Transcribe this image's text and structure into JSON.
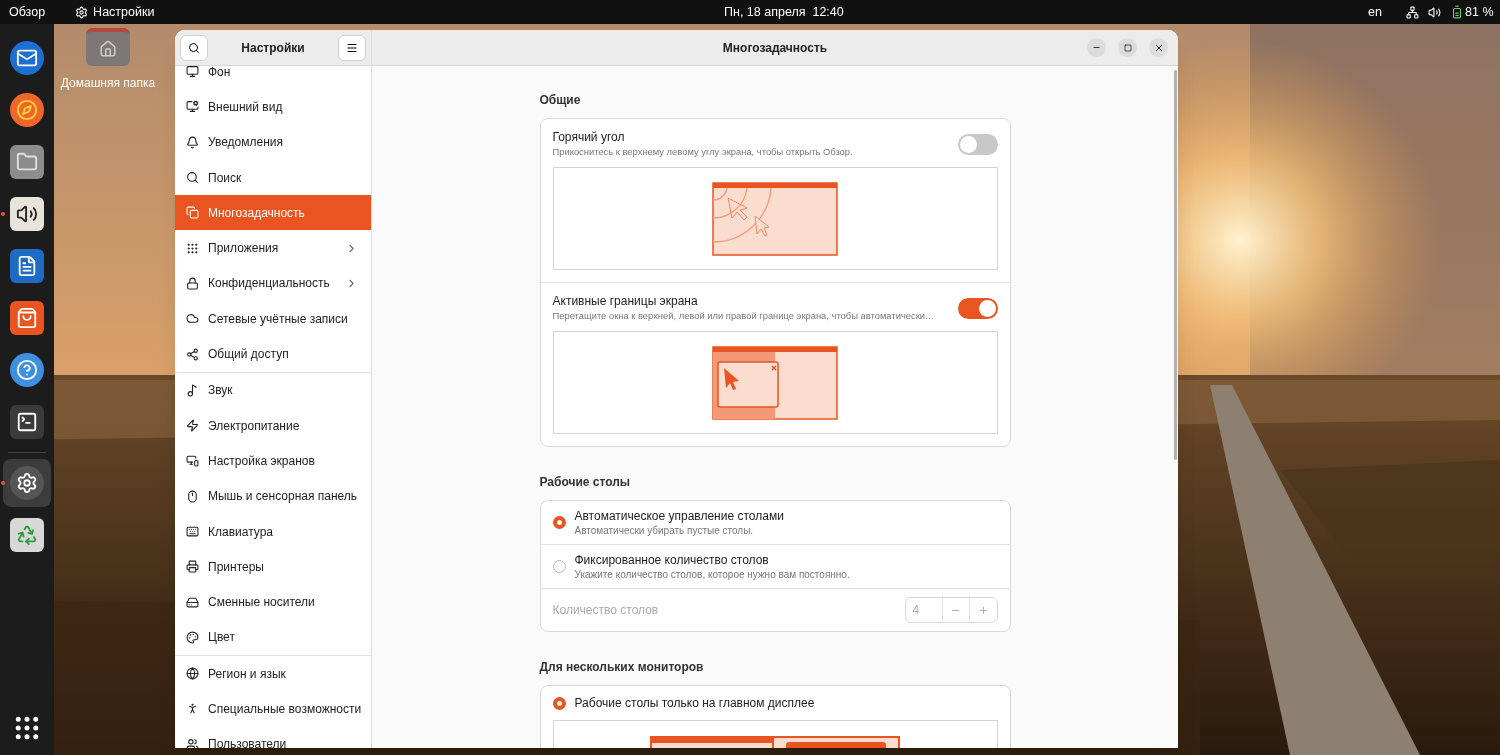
{
  "top_bar": {
    "activities": "Обзор",
    "app_name": "Настройки",
    "clock": "Пн, 18 апреля  12:40",
    "language": "en",
    "battery": "81 %"
  },
  "dock": {
    "items": [
      {
        "running": false,
        "selected": false
      },
      {
        "running": false,
        "selected": false
      },
      {
        "running": false,
        "selected": false
      },
      {
        "running": true,
        "selected": false
      },
      {
        "running": false,
        "selected": false
      },
      {
        "running": false,
        "selected": false
      },
      {
        "running": false,
        "selected": false
      },
      {
        "running": false,
        "selected": false
      },
      {
        "running": true,
        "selected": true
      },
      {
        "running": false,
        "selected": false
      }
    ]
  },
  "desktop": {
    "icons": [
      {
        "label": "Домашняя папка"
      }
    ]
  },
  "window": {
    "sidebar": {
      "title": "Настройки",
      "groups": [
        [
          {
            "label": "Фон",
            "selected": false,
            "expandable": false
          },
          {
            "label": "Внешний вид",
            "selected": false,
            "expandable": false
          },
          {
            "label": "Уведомления",
            "selected": false,
            "expandable": false
          },
          {
            "label": "Поиск",
            "selected": false,
            "expandable": false
          },
          {
            "label": "Многозадачность",
            "selected": true,
            "expandable": false
          },
          {
            "label": "Приложения",
            "selected": false,
            "expandable": true
          },
          {
            "label": "Конфиденциальность",
            "selected": false,
            "expandable": true
          },
          {
            "label": "Сетевые учётные записи",
            "selected": false,
            "expandable": false
          },
          {
            "label": "Общий доступ",
            "selected": false,
            "expandable": false
          }
        ],
        [
          {
            "label": "Звук",
            "selected": false,
            "expandable": false
          },
          {
            "label": "Электропитание",
            "selected": false,
            "expandable": false
          },
          {
            "label": "Настройка экранов",
            "selected": false,
            "expandable": false
          },
          {
            "label": "Мышь и сенсорная панель",
            "selected": false,
            "expandable": false
          },
          {
            "label": "Клавиатура",
            "selected": false,
            "expandable": false
          },
          {
            "label": "Принтеры",
            "selected": false,
            "expandable": false
          },
          {
            "label": "Сменные носители",
            "selected": false,
            "expandable": false
          },
          {
            "label": "Цвет",
            "selected": false,
            "expandable": false
          }
        ],
        [
          {
            "label": "Регион и язык",
            "selected": false,
            "expandable": false
          },
          {
            "label": "Специальные возможности",
            "selected": false,
            "expandable": false
          },
          {
            "label": "Пользователи",
            "selected": false,
            "expandable": false
          }
        ]
      ]
    },
    "title": "Многозадачность",
    "sections": [
      {
        "heading": "Общие",
        "rows": [
          {
            "kind": "toggle",
            "title": "Горячий угол",
            "subtitle": "Прикоснитесь к верхнему левому углу экрана, чтобы открыть Обзор.",
            "on": false
          },
          {
            "kind": "toggle",
            "title": "Активные границы экрана",
            "subtitle": "Перетащите окна к верхней, левой или правой границе экрана, чтобы автоматически…",
            "on": true
          }
        ]
      },
      {
        "heading": "Рабочие столы",
        "rows": [
          {
            "kind": "radio",
            "title": "Автоматическое управление столами",
            "subtitle": "Автоматически убирать пустые столы.",
            "selected": true
          },
          {
            "kind": "radio",
            "title": "Фиксированное количество столов",
            "subtitle": "Укажите количество столов, которое нужно вам постоянно.",
            "selected": false
          },
          {
            "kind": "spin",
            "label": "Количество столов",
            "value": "4",
            "disabled": true
          }
        ]
      },
      {
        "heading": "Для нескольких мониторов",
        "rows": [
          {
            "kind": "radio",
            "title": "Рабочие столы только на главном дисплее",
            "selected": true
          }
        ]
      }
    ]
  }
}
